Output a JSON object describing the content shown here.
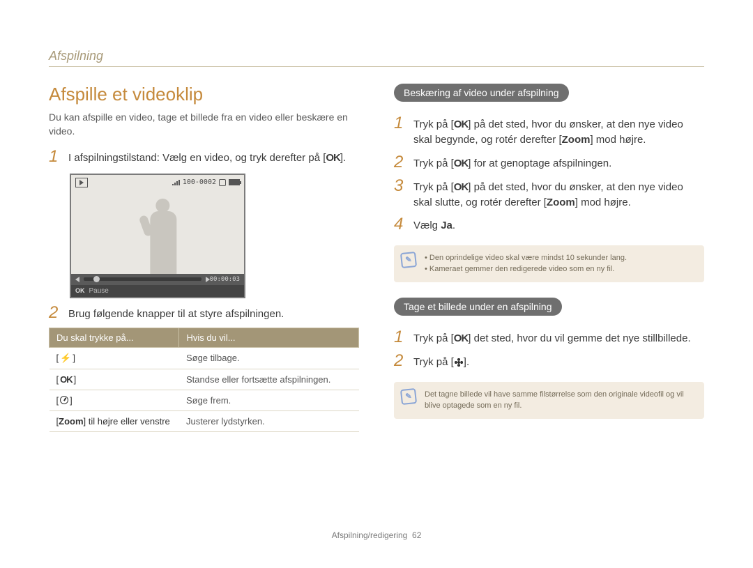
{
  "breadcrumb": "Afspilning",
  "title": "Afspille et videoklip",
  "intro": "Du kan afspille en video, tage et billede fra en video eller beskære en video.",
  "left": {
    "step1_a": "I afspilningstilstand: Vælg en video, og tryk derefter på [",
    "ok": "OK",
    "step1_b": "].",
    "step2": "Brug følgende knapper til at styre afspilningen.",
    "video": {
      "counter": "100-0002",
      "time": "00:00:03",
      "pause_label_ok": "OK",
      "pause_label": "Pause"
    },
    "table": {
      "h1": "Du skal trykke på...",
      "h2": "Hvis du vil...",
      "rows": [
        {
          "key_before": "[",
          "icon": "flash",
          "key_after": "]",
          "action": "Søge tilbage."
        },
        {
          "key_before": "[",
          "icon": "ok",
          "key_after": "]",
          "action": "Standse eller fortsætte afspilningen."
        },
        {
          "key_before": "[",
          "icon": "timer",
          "key_after": "]",
          "action": "Søge frem."
        },
        {
          "key_before": "[",
          "icon": "zoom",
          "key_after": "] til højre eller venstre",
          "action": "Justerer lydstyrken."
        }
      ]
    }
  },
  "right": {
    "section1_title": "Beskæring af video under afspilning",
    "s1": {
      "1a": "Tryk på [",
      "ok": "OK",
      "1b": "] på det sted, hvor du ønsker, at den nye video skal begynde, og rotér derefter [",
      "zoom": "Zoom",
      "1c": "] mod højre.",
      "2a": "Tryk på [",
      "2b": "] for at genoptage afspilningen.",
      "3a": "Tryk på [",
      "3b": "] på det sted, hvor du ønsker, at den nye video skal slutte, og rotér derefter [",
      "3c": "] mod højre.",
      "4a": "Vælg ",
      "ja": "Ja",
      "4b": "."
    },
    "note1": {
      "l1": "Den oprindelige video skal være mindst 10 sekunder lang.",
      "l2": "Kameraet gemmer den redigerede video som en ny fil."
    },
    "section2_title": "Tage et billede under en afspilning",
    "s2": {
      "1a": "Tryk på [",
      "ok": "OK",
      "1b": "] det sted, hvor du vil gemme det nye stillbillede.",
      "2a": "Tryk på [",
      "2b": "]."
    },
    "note2": "Det tagne billede vil have samme filstørrelse som den originale videofil og vil blive optagede som en ny fil."
  },
  "footer": {
    "text": "Afspilning/redigering",
    "page": "62"
  }
}
